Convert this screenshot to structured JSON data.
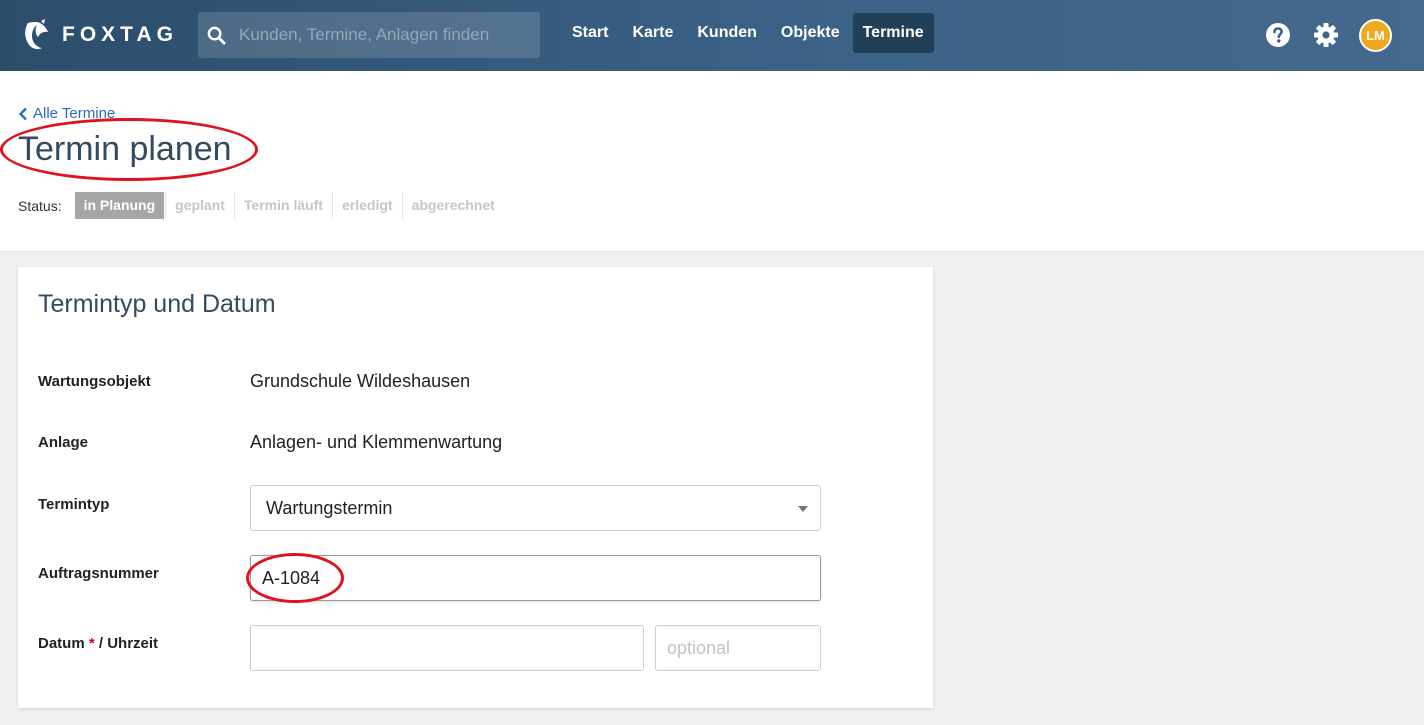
{
  "app": {
    "logo_text": "FOXTAG"
  },
  "search": {
    "placeholder": "Kunden, Termine, Anlagen finden"
  },
  "nav": {
    "items": [
      {
        "label": "Start",
        "active": false
      },
      {
        "label": "Karte",
        "active": false
      },
      {
        "label": "Kunden",
        "active": false
      },
      {
        "label": "Objekte",
        "active": false
      },
      {
        "label": "Termine",
        "active": true
      }
    ]
  },
  "topbar_icons": {
    "help": "help-icon",
    "settings": "gear-icon",
    "avatar_initials": "LM"
  },
  "header": {
    "back_link": "Alle Termine",
    "title": "Termin planen",
    "status_label": "Status:",
    "status_steps": [
      {
        "label": "in Planung",
        "active": true
      },
      {
        "label": "geplant",
        "active": false
      },
      {
        "label": "Termin läuft",
        "active": false
      },
      {
        "label": "erledigt",
        "active": false
      },
      {
        "label": "abgerechnet",
        "active": false
      }
    ]
  },
  "card": {
    "title": "Termintyp und Datum",
    "wartungsobjekt_label": "Wartungsobjekt",
    "wartungsobjekt_value": "Grundschule Wildeshausen",
    "anlage_label": "Anlage",
    "anlage_value": "Anlagen- und Klemmenwartung",
    "termintyp_label": "Termintyp",
    "termintyp_value": "Wartungstermin",
    "auftragsnummer_label": "Auftragsnummer",
    "auftragsnummer_value": "A-1084",
    "datum_label": "Datum",
    "datum_required": "*",
    "datum_suffix": "/ Uhrzeit",
    "datum_value": "",
    "uhrzeit_placeholder": "optional"
  },
  "colors": {
    "topbar": "#3b6186",
    "accent_link": "#2a6bc2",
    "avatar": "#f0a81d",
    "annotation": "#e0121b",
    "status_active": "#a6a6a6"
  }
}
